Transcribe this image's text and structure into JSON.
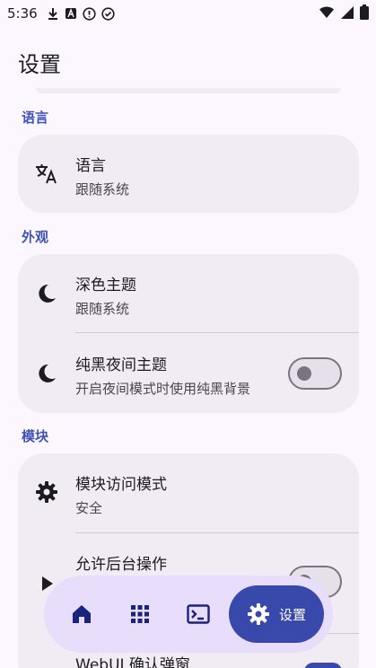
{
  "status": {
    "time": "5:36"
  },
  "page": {
    "title": "设置"
  },
  "sections": {
    "language": {
      "label": "语言",
      "item_title": "语言",
      "item_subtitle": "跟随系统"
    },
    "appearance": {
      "label": "外观",
      "dark_theme_title": "深色主题",
      "dark_theme_subtitle": "跟随系统",
      "pure_black_title": "纯黑夜间主题",
      "pure_black_subtitle": "开启夜间模式时使用纯黑背景",
      "pure_black_enabled": false
    },
    "module": {
      "label": "模块",
      "access_mode_title": "模块访问模式",
      "access_mode_subtitle": "安全",
      "background_title": "允许后台操作",
      "webui_title": "WebUI 确认弹窗"
    }
  },
  "nav": {
    "active_label": "设置"
  },
  "colors": {
    "accent": "#3949ab",
    "card": "#f1ecf4",
    "background": "#fcf7ff"
  }
}
